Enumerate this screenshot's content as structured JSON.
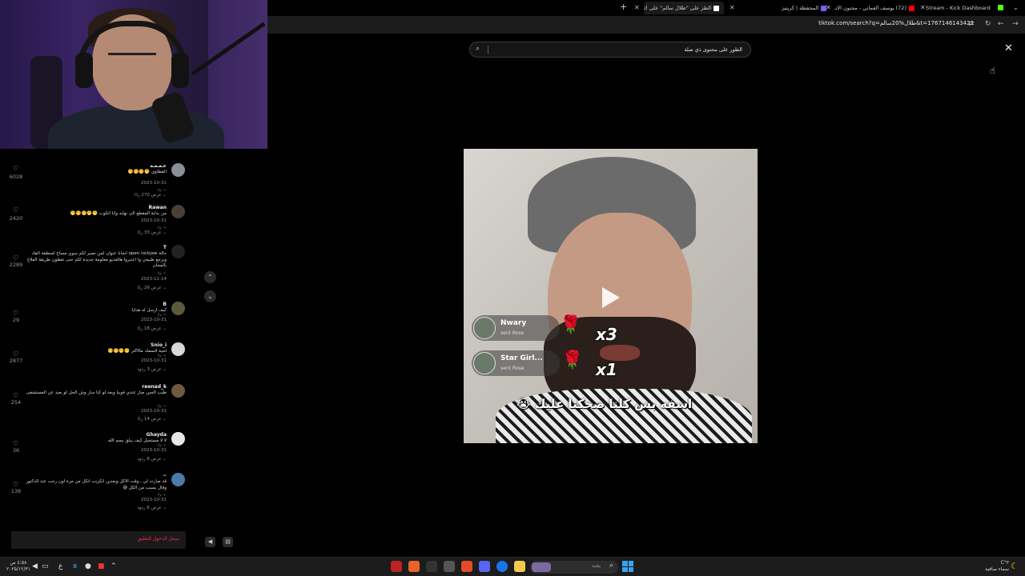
{
  "browser": {
    "tabs": [
      {
        "label": "Stream - Kick Dashboard",
        "favicon_color": "#53fc18"
      },
      {
        "label": "(72) يوسف العماني - مجنون الاتـ",
        "favicon_color": "#ff0000"
      },
      {
        "label": "المحفظة | كريتيز",
        "favicon_color": "#7b5cff"
      },
      {
        "label": "الطز على \"طلال سالم\" على ك",
        "favicon_color": "#ffffff",
        "active": true
      }
    ],
    "url": "tiktok.com/search?q=طلال%20سالم&t=1767146143422"
  },
  "search": {
    "value": "الطور على محتوى ذي صلة",
    "icon": "search-icon"
  },
  "comments": [
    {
      "username": "ﻋـﻌـﻌـﻌ",
      "text": "القطاوي 🤭🤭🤭🤭",
      "date": "2023-10-31",
      "reply_marker": "رد",
      "replies": "عرض 270 ردًا",
      "likes": "6028",
      "avatar_color": "#8a8f99"
    },
    {
      "username": "Rawan",
      "text": "من بداية المقطع الى نهايه وانا اتكوب 🤭🤭🤭🤭🤭",
      "date": "2023-10-31",
      "reply_marker": "رد",
      "replies": "عرض 33 ردًا",
      "likes": "2420",
      "avatar_color": "#4a3f35"
    },
    {
      "username": "T",
      "text": "حالة open lockjaw انجانا عنوان لمن تصير لكم سوي مساج لمنطقة الفك وبرجع طبيعي وا اعتبروا هالفديو معلومة جديدة لكم حتى تعطون طريقة العلاج بالمجان",
      "date": "2023-11-14",
      "reply_marker": "رد",
      "replies": "عرض 26 ردًا",
      "likes": "2289",
      "avatar_color": "#222222"
    },
    {
      "username": "B",
      "text": "كيف ارسل له هدايا",
      "date": "2023-10-31",
      "reply_marker": "رد",
      "replies": "عرض 18 ردًا",
      "likes": "29",
      "avatar_color": "#5b5a3c"
    },
    {
      "username": "Snio_i",
      "text": "لحية السمك ماااكثر 🤭🤭🤭🤭",
      "date": "2023-10-31",
      "reply_marker": "رد",
      "replies": "عرض 3 ردود",
      "likes": "2877",
      "avatar_color": "#d8d8d8"
    },
    {
      "username": "reenad_k",
      "text": "طيب الحين صار عندي فوبيا وبعد لو كنا سار وش الحل لو بعيد عن المستشفى",
      "date": "2023-10-31",
      "reply_marker": "رد",
      "replies": "عرض 14 ردًا",
      "likes": "254",
      "avatar_color": "#6e5a3e"
    },
    {
      "username": "Ghayda",
      "text": "لا لا مستحيل كيف يبلق بسم الله",
      "date": "2023-10-31",
      "reply_marker": "رد",
      "replies": "عرض 8 ردود",
      "likes": "36",
      "avatar_color": "#e8e8e8"
    },
    {
      "username": "~",
      "text": "قد صارت لي ، وقت الاكل وبعدين انكريت انكل من مرة اون رحت عند الدكتور وقال بسبب من الكل 😅",
      "date": "2023-10-31",
      "reply_marker": "رد",
      "replies": "عرض 6 ردود",
      "likes": "138",
      "avatar_color": "#4d7aa6"
    }
  ],
  "login_prompt": "سجل الدخول للتعليق",
  "video": {
    "gifts": [
      {
        "name": "Nwary",
        "sub": "sent Rose",
        "count": "x3"
      },
      {
        "name": "Star Girl...",
        "sub": "sent Rose",
        "count": "x1"
      }
    ],
    "caption": "اسفه بس كلنا ضحكنا عليك 😭",
    "play_icon": "play-icon"
  },
  "taskbar": {
    "time": "٤:٥٨ ص",
    "date": "٢٠٢٥/١٢/٣١",
    "lang": "ع",
    "search_placeholder": "بحث",
    "weather_temp": "٣°C",
    "weather_desc": "سماء صافية"
  }
}
